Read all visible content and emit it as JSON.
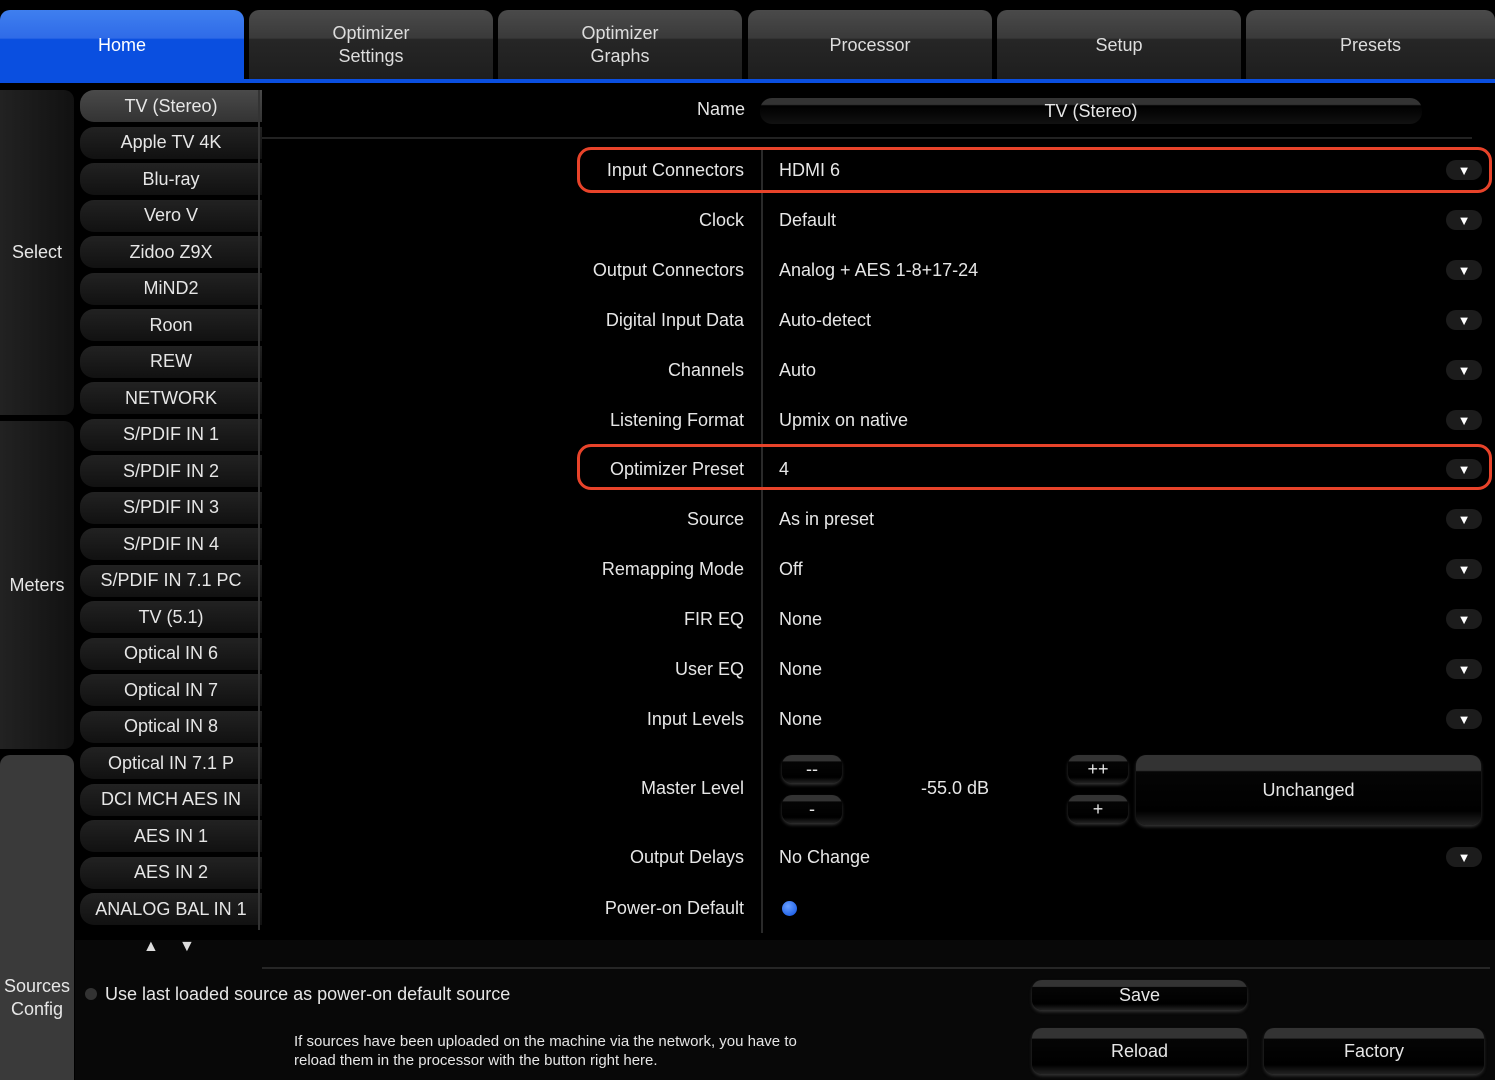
{
  "tabs": [
    {
      "label": "Home"
    },
    {
      "label": "Optimizer\nSettings"
    },
    {
      "label": "Optimizer\nGraphs"
    },
    {
      "label": "Processor"
    },
    {
      "label": "Setup"
    },
    {
      "label": "Presets"
    }
  ],
  "sidebar": {
    "select": "Select",
    "meters": "Meters",
    "sources_config": "Sources\nConfig"
  },
  "sources": [
    "TV (Stereo)",
    "Apple TV 4K",
    "Blu-ray",
    "Vero V",
    "Zidoo Z9X",
    "MiND2",
    "Roon",
    "REW",
    "NETWORK",
    "S/PDIF IN 1",
    "S/PDIF IN 2",
    "S/PDIF IN 3",
    "S/PDIF IN 4",
    "S/PDIF IN 7.1 PC",
    "TV (5.1)",
    "Optical IN 6",
    "Optical IN 7",
    "Optical IN 8",
    "Optical IN 7.1 P",
    "DCI MCH AES IN",
    "AES IN 1",
    "AES IN 2",
    "ANALOG BAL IN 1"
  ],
  "name": {
    "label": "Name",
    "value": "TV (Stereo)"
  },
  "fields": [
    {
      "label": "Input Connectors",
      "value": "HDMI 6"
    },
    {
      "label": "Clock",
      "value": "Default"
    },
    {
      "label": "Output Connectors",
      "value": "Analog + AES 1-8+17-24"
    },
    {
      "label": "Digital Input Data",
      "value": "Auto-detect"
    },
    {
      "label": "Channels",
      "value": "Auto"
    },
    {
      "label": "Listening Format",
      "value": "Upmix on native"
    },
    {
      "label": "Optimizer Preset",
      "value": "4"
    },
    {
      "label": "Source",
      "value": "As in preset"
    },
    {
      "label": "Remapping Mode",
      "value": "Off"
    },
    {
      "label": "FIR EQ",
      "value": "None"
    },
    {
      "label": "User EQ",
      "value": "None"
    },
    {
      "label": "Input Levels",
      "value": "None"
    }
  ],
  "master": {
    "label": "Master Level",
    "value": "-55.0 dB",
    "dec_big": "--",
    "dec": "-",
    "inc_big": "++",
    "inc": "+",
    "mode": "Unchanged"
  },
  "output_delays": {
    "label": "Output Delays",
    "value": "No Change"
  },
  "power_on": {
    "label": "Power-on Default"
  },
  "bottom": {
    "checkbox_label": "Use last loaded source as power-on default source",
    "note1": "If sources have been uploaded on the machine via the network, you have to",
    "note2": "reload them in the processor with the button right here.",
    "save": "Save",
    "reload": "Reload",
    "factory": "Factory"
  },
  "colors": {
    "accent": "#0a4fe0",
    "highlight": "#e8432a"
  }
}
